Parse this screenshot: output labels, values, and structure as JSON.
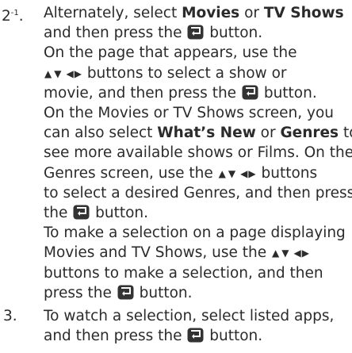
{
  "steps": [
    {
      "number": "2",
      "superscript": "-1",
      "paragraphs": [
        {
          "line1_a": "Alternately, select ",
          "movies": "Movies",
          "line1_or": " or ",
          "tvshows": "TV Shows",
          "line2_a": "and then press the ",
          "line2_b": " button."
        },
        {
          "line1": "On the page that appears, use the",
          "line2_b": " buttons to select a show or",
          "line3_a": "movie, and then press the ",
          "line3_b": " button."
        },
        {
          "line1": "On the Movies or TV Shows screen, you",
          "line2_a": "can also select ",
          "whatsnew": "What’s New",
          "line2_or": " or ",
          "genres": "Genres",
          "line2_b": " to",
          "line3": "see more available shows or Films. On the",
          "line4_a": "Genres screen, use the ",
          "line4_b": " buttons",
          "line5": "to select a desired Genres, and then press",
          "line6_a": "the ",
          "line6_b": " button."
        },
        {
          "line1": "To make a selection on a page displaying",
          "line2_a": "Movies and TV Shows, use the ",
          "line3_a": "buttons to make a selection, and then",
          "line4_a": "press the ",
          "line4_b": " button."
        }
      ]
    },
    {
      "number": "3.",
      "paragraphs": [
        {
          "line1": "To watch a selection, select listed apps,",
          "line2_a": "and then press the ",
          "line2_b": " button."
        }
      ]
    }
  ],
  "icons": {
    "enter_button": "enter-button-icon",
    "arrow_buttons": "direction-arrows-icon"
  },
  "colors": {
    "text": "#2b2b2b",
    "icon": "#333333"
  }
}
